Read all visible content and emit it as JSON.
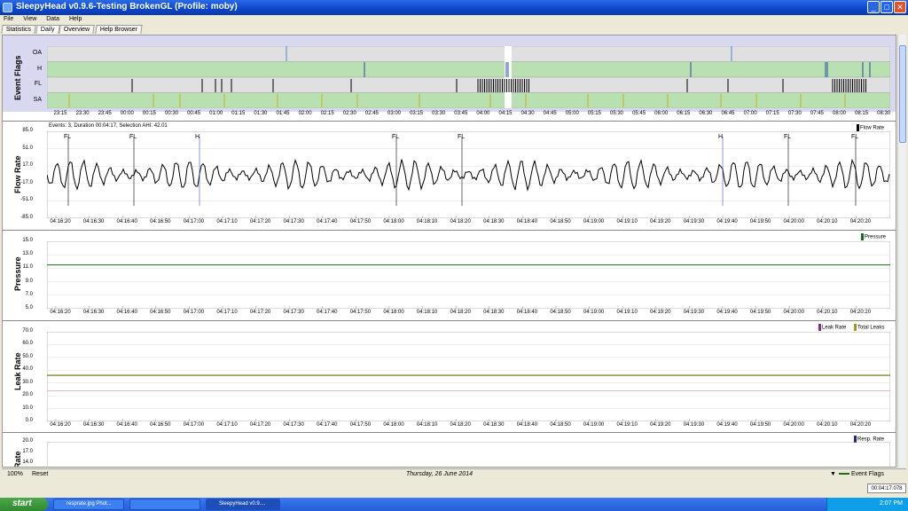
{
  "window": {
    "title": "SleepyHead v0.9.6-Testing BrokenGL (Profile: moby)",
    "min": "_",
    "max": "□",
    "close": "✕"
  },
  "menu": [
    "File",
    "View",
    "Data",
    "Help"
  ],
  "tabs": [
    "Statistics",
    "Daily",
    "Overview",
    "Help Browser"
  ],
  "event_flags": {
    "title": "Event Flags",
    "rows": [
      "OA",
      "H",
      "FL",
      "SA"
    ],
    "time_labels": [
      "23:15",
      "23:30",
      "23:45",
      "00:00",
      "00:15",
      "00:30",
      "00:45",
      "01:00",
      "01:15",
      "01:30",
      "01:45",
      "02:00",
      "02:15",
      "02:30",
      "02:45",
      "03:00",
      "03:15",
      "03:30",
      "03:45",
      "04:00",
      "04:15",
      "04:30",
      "04:45",
      "05:00",
      "05:15",
      "05:30",
      "05:45",
      "06:00",
      "06:15",
      "06:30",
      "06:45",
      "07:00",
      "07:15",
      "07:30",
      "07:45",
      "08:00",
      "08:15",
      "08:30"
    ]
  },
  "flow": {
    "title": "Flow Rate",
    "info": "Events: 3, Duration 00:04:17, Selection AHI: 42.01",
    "legend": "Flow Rate",
    "yticks": [
      "85.0",
      "51.0",
      "17.0",
      "-17.0",
      "-51.0",
      "-85.0"
    ],
    "annotations": [
      "FL",
      "FL",
      "H",
      "FL",
      "FL",
      "H",
      "FL",
      "FL"
    ]
  },
  "pressure": {
    "title": "Pressure",
    "legend": "Pressure",
    "yticks": [
      "15.0",
      "13.0",
      "11.0",
      "9.0",
      "7.0",
      "5.0"
    ],
    "value": 11.5,
    "ylim": [
      5,
      15
    ]
  },
  "leak": {
    "title": "Leak Rate",
    "legend_leak": "Leak Rate",
    "legend_total": "Total Leaks",
    "yticks": [
      "70.0",
      "60.0",
      "50.0",
      "40.0",
      "30.0",
      "20.0",
      "10.0",
      "0.0"
    ],
    "total_value": 36,
    "leak_value": 24,
    "ylim": [
      0,
      70
    ]
  },
  "resp": {
    "title": "Rate",
    "legend": "Resp. Rate",
    "yticks": [
      "20.0",
      "17.0",
      "14.0"
    ]
  },
  "time_axis": [
    "04:16:20",
    "04:16:30",
    "04:16:40",
    "04:16:50",
    "04:17:00",
    "04:17:10",
    "04:17:20",
    "04:17:30",
    "04:17:40",
    "04:17:50",
    "04:18:00",
    "04:18:10",
    "04:18:20",
    "04:18:30",
    "04:18:40",
    "04:18:50",
    "04:19:00",
    "04:19:10",
    "04:19:20",
    "04:19:30",
    "04:19:40",
    "04:19:50",
    "04:20:00",
    "04:20:10",
    "04:20:20"
  ],
  "status": {
    "zoom": "100%",
    "reset": "Reset",
    "date": "Thursday, 26 June 2014",
    "event_flags": "Event Flags",
    "time": "00:04:17.078"
  },
  "taskbar": {
    "start": "start",
    "tasks": [
      "resprate.jpg Phot...",
      "",
      "SleepyHead v0.9...."
    ],
    "clock": "2:07 PM"
  },
  "colors": {
    "flow_line": "#000000",
    "pressure_line": "#1a6e1a",
    "total_leak": "#6a6a00",
    "leak_rate": "#e0a0a0",
    "flag_green": "#b8e0b0",
    "flag_gray": "#e0e0e0"
  }
}
